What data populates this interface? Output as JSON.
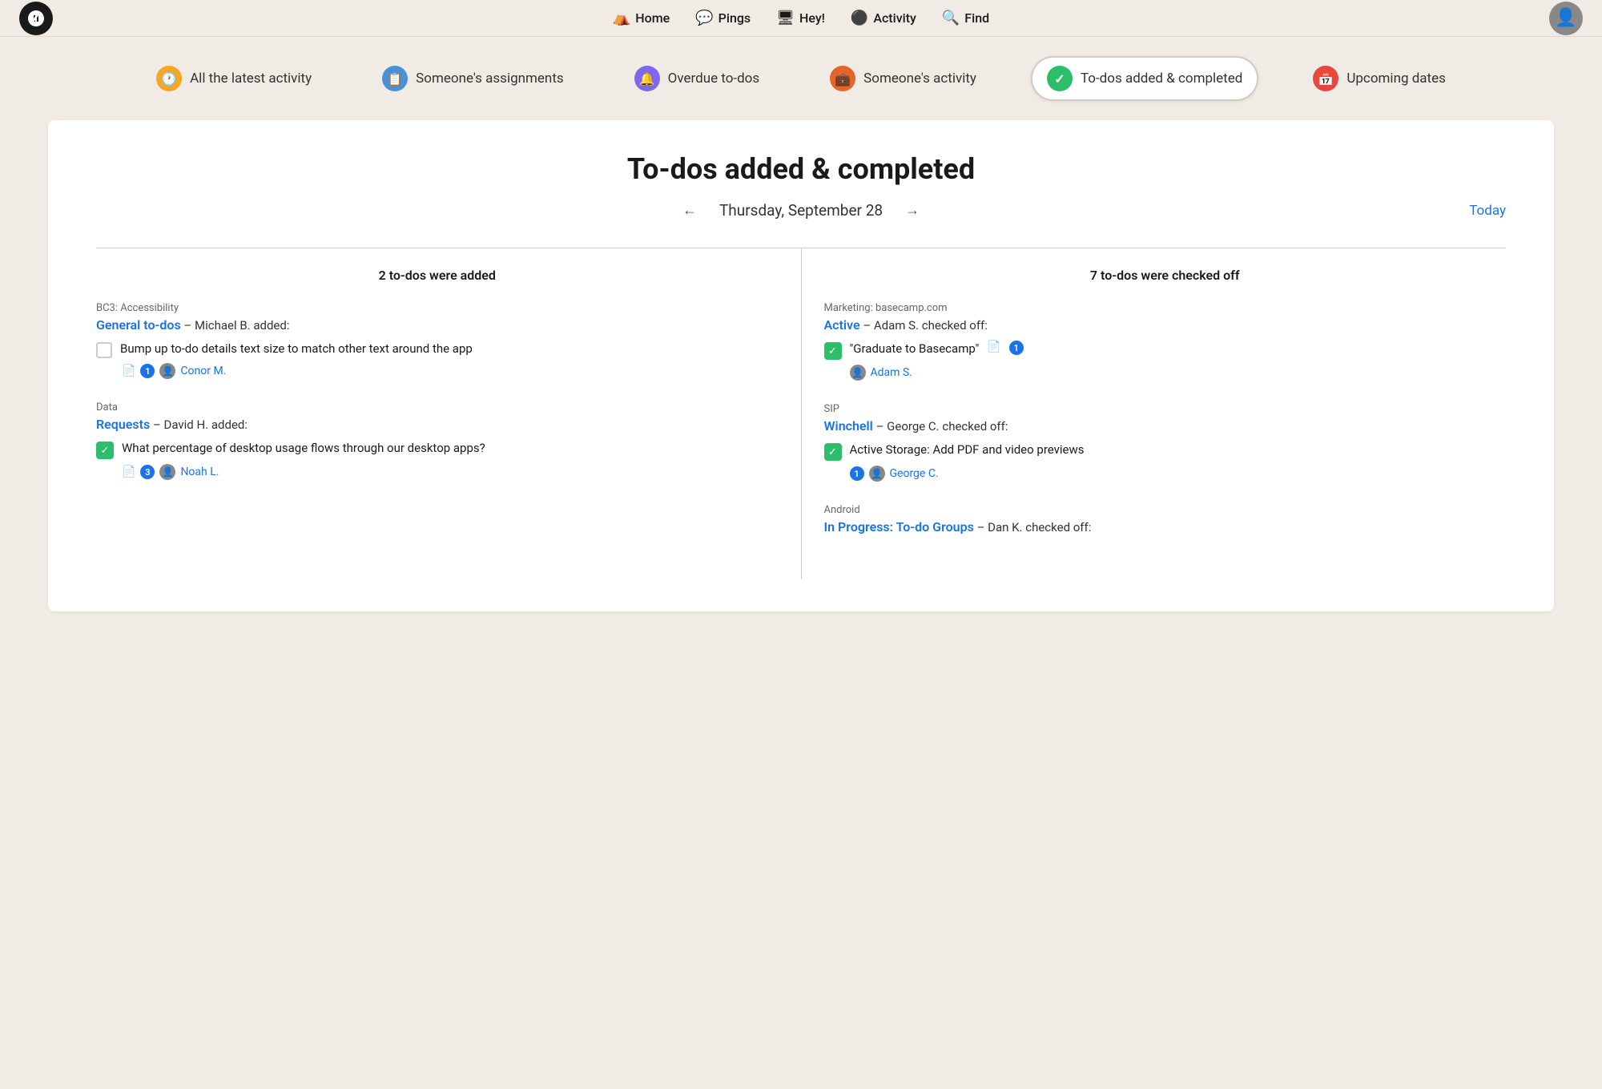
{
  "nav": {
    "logo_alt": "Basecamp logo",
    "items": [
      {
        "label": "Home",
        "icon": "⛺"
      },
      {
        "label": "Pings",
        "icon": "💬"
      },
      {
        "label": "Hey!",
        "icon": "🖥"
      },
      {
        "label": "Activity",
        "icon": "🔵"
      },
      {
        "label": "Find",
        "icon": "🔍"
      }
    ]
  },
  "filter_bar": {
    "items": [
      {
        "label": "All the latest activity",
        "icon_color": "icon-yellow",
        "icon": "🕐",
        "active": false
      },
      {
        "label": "Someone's assignments",
        "icon_color": "icon-blue",
        "icon": "📋",
        "active": false
      },
      {
        "label": "Overdue to-dos",
        "icon_color": "icon-purple",
        "icon": "🔔",
        "active": false
      },
      {
        "label": "Someone's activity",
        "icon_color": "icon-orange",
        "icon": "💼",
        "active": false
      },
      {
        "label": "To-dos added & completed",
        "icon_color": "icon-green",
        "icon": "✓",
        "active": true
      },
      {
        "label": "Upcoming dates",
        "icon_color": "icon-red",
        "icon": "📅",
        "active": false
      }
    ]
  },
  "page": {
    "title": "To-dos added & completed",
    "date": "Thursday, September 28",
    "today_label": "Today",
    "col_added_header": "2 to-dos were added",
    "col_completed_header": "7 to-dos were checked off"
  },
  "added_items": [
    {
      "project": "BC3: Accessibility",
      "list_link": "General to-dos",
      "added_by": "Michael B. added:",
      "checked": false,
      "text": "Bump up to-do details text size to match other text around the app",
      "comment_count": 1,
      "assigned_to": "Conor M."
    },
    {
      "project": "Data",
      "list_link": "Requests",
      "added_by": "David H. added:",
      "checked": true,
      "text": "What percentage of desktop usage flows through our desktop apps?",
      "comment_count": 3,
      "assigned_to": "Noah L."
    }
  ],
  "completed_items": [
    {
      "project": "Marketing: basecamp.com",
      "list_link": "Active",
      "checked_by": "Adam S. checked off:",
      "checked": true,
      "text": "\"Graduate to Basecamp\"",
      "comment_count": 1,
      "assigned_to": "Adam S."
    },
    {
      "project": "SIP",
      "list_link": "Winchell",
      "checked_by": "George C. checked off:",
      "checked": true,
      "text": "Active Storage: Add PDF and video previews",
      "comment_count": 1,
      "assigned_to": "George C."
    },
    {
      "project": "Android",
      "list_link": "In Progress: To-do Groups",
      "checked_by": "Dan K. checked off:",
      "checked": true,
      "text": "",
      "comment_count": 0,
      "assigned_to": ""
    }
  ]
}
